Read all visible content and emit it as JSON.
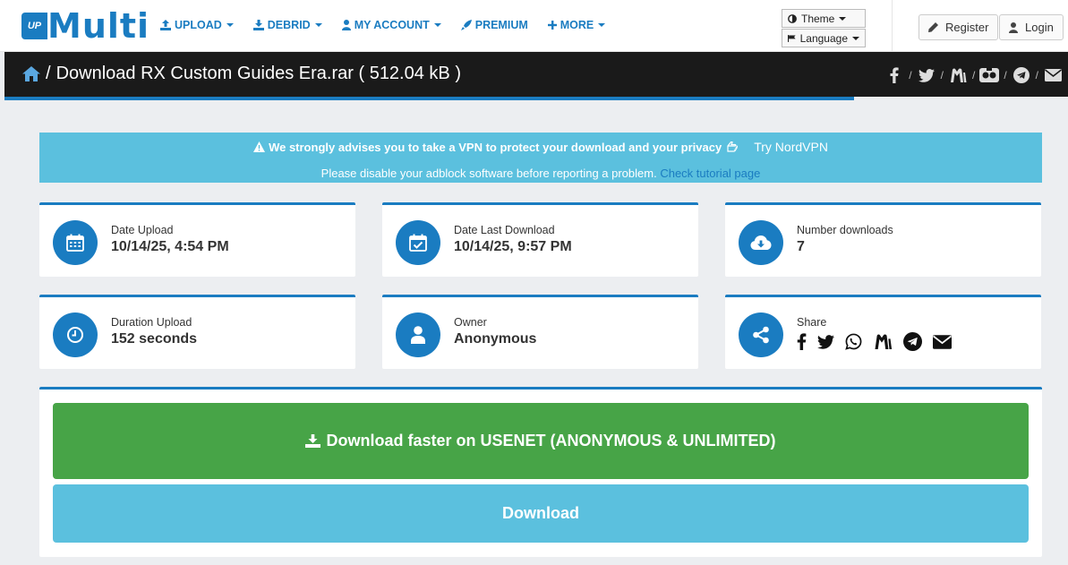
{
  "brand": {
    "up": "UP",
    "name": "Multi",
    "color": "#1a7cc1"
  },
  "nav": {
    "upload": "UPLOAD",
    "debrid": "DEBRID",
    "account": "MY ACCOUNT",
    "premium": "PREMIUM",
    "more": "MORE"
  },
  "header": {
    "theme": "Theme",
    "language": "Language",
    "register": "Register",
    "login": "Login"
  },
  "title": {
    "separator": "/",
    "text": "Download RX Custom Guides Era.rar ( 512.04 kB )"
  },
  "social_separator": "/",
  "alert": {
    "message": "We strongly advises you to take a VPN to protect your download and your privacy",
    "vpn_link": "Try NordVPN",
    "adblock_note": "Please disable your adblock software before reporting a problem.",
    "tutorial_link": "Check tutorial page",
    "bg_color": "#5bc0de"
  },
  "info": {
    "date_upload": {
      "label": "Date Upload",
      "value": "10/14/25, 4:54 PM",
      "icon": "calendar-icon"
    },
    "date_last_download": {
      "label": "Date Last Download",
      "value": "10/14/25, 9:57 PM",
      "icon": "calendar-check-icon"
    },
    "number_downloads": {
      "label": "Number downloads",
      "value": "7",
      "icon": "cloud-download-icon"
    },
    "duration_upload": {
      "label": "Duration Upload",
      "value": "152 seconds",
      "icon": "clock-icon"
    },
    "owner": {
      "label": "Owner",
      "value": "Anonymous",
      "icon": "user-icon"
    },
    "share": {
      "label": "Share",
      "icon": "share-icon"
    }
  },
  "download": {
    "usenet_label": "Download faster on USENET (ANONYMOUS & UNLIMITED)",
    "usenet_color": "#47a447",
    "download_label": "Download",
    "download_color": "#5bc0de"
  }
}
